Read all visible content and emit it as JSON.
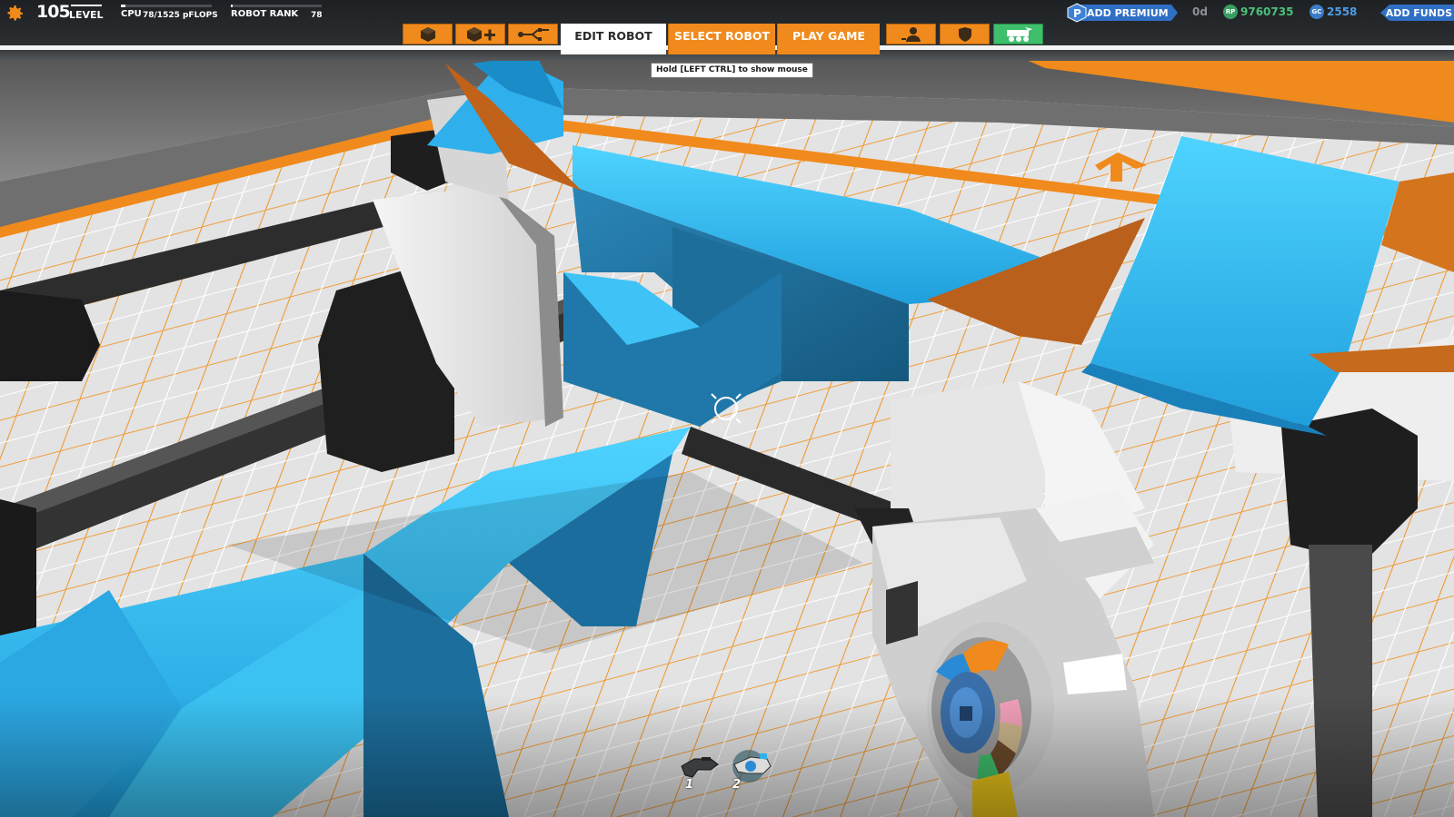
{
  "hud": {
    "level_number": "105",
    "level_label": "LEVEL",
    "cpu_label": "CPU",
    "cpu_value": "78/1525 pFLOPS",
    "cpu_fill": 0.05,
    "rank_label": "ROBOT RANK",
    "rank_value": "78"
  },
  "nav": {
    "icon_buttons": [
      "cube-icon",
      "cube-add-icon",
      "connect-icon",
      "player-icon",
      "shield-icon",
      "robot-icon"
    ],
    "tabs": {
      "edit": "EDIT ROBOT",
      "select": "SELECT ROBOT",
      "play": "PLAY GAME"
    },
    "active_tab": "EDIT ROBOT"
  },
  "tooltip": "Hold [LEFT CTRL] to show mouse",
  "account": {
    "premium_label": "ADD PREMIUM",
    "premium_days": "0d",
    "rp_icon": "RP",
    "rp_value": "9760735",
    "gc_icon": "GC",
    "gc_value": "2558",
    "funds_label": "ADD FUNDS"
  },
  "hotbar": {
    "slot1": "1",
    "slot2": "2",
    "selected": 2
  },
  "colors": {
    "accent_orange": "#f08a1c",
    "cube_blue": "#2fb0ec",
    "premium_blue": "#2f6fc4",
    "rp_green": "#4cc07a",
    "gc_blue": "#4e9de8"
  }
}
